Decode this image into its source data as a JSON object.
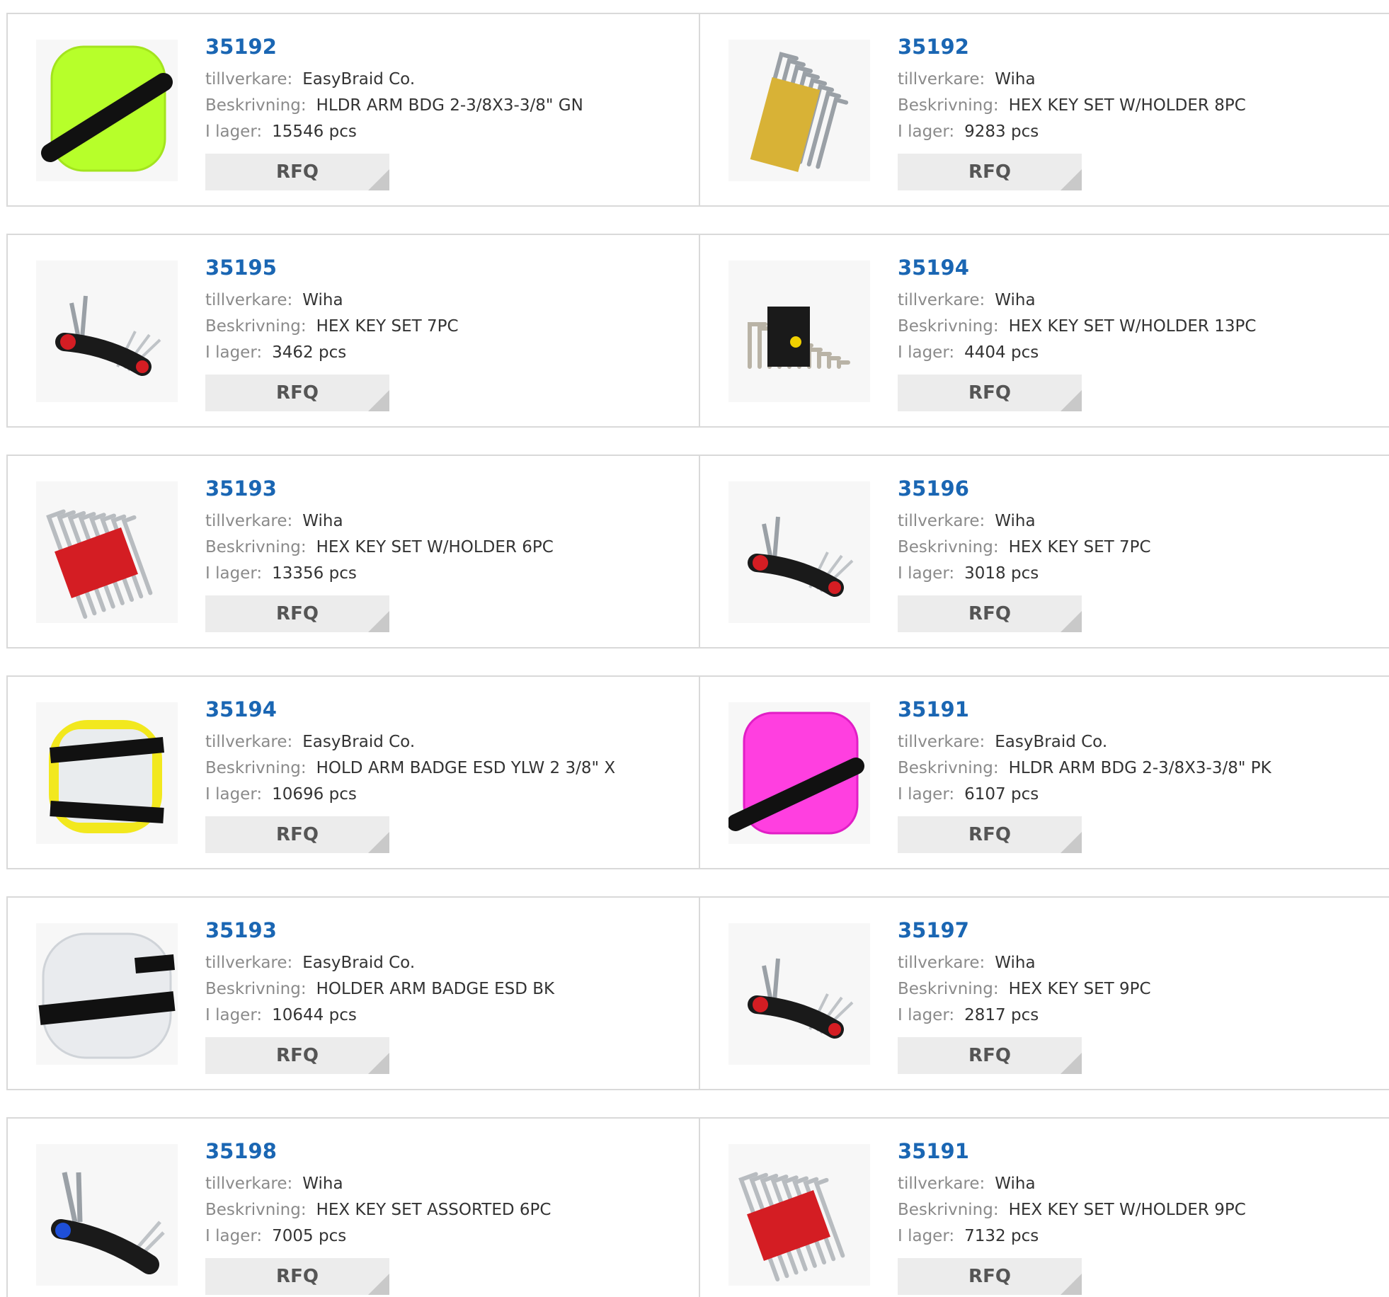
{
  "labels": {
    "manufacturer": "tillverkare:",
    "description": "Beskrivning:",
    "stock": "I lager:",
    "rfq": "RFQ"
  },
  "products": [
    {
      "part": "35192",
      "manufacturer": "EasyBraid Co.",
      "description": "HLDR ARM BDG 2-3/8X3-3/8\" GN",
      "stock": "15546 pcs",
      "image": "arm-badge-green"
    },
    {
      "part": "35192",
      "manufacturer": "Wiha",
      "description": "HEX KEY SET W/HOLDER 8PC",
      "stock": "9283 pcs",
      "image": "hex-key-holder-yellow"
    },
    {
      "part": "35195",
      "manufacturer": "Wiha",
      "description": "HEX KEY SET 7PC",
      "stock": "3462 pcs",
      "image": "folding-hex-key"
    },
    {
      "part": "35194",
      "manufacturer": "Wiha",
      "description": "HEX KEY SET W/HOLDER 13PC",
      "stock": "4404 pcs",
      "image": "hex-key-holder-black"
    },
    {
      "part": "35193",
      "manufacturer": "Wiha",
      "description": "HEX KEY SET W/HOLDER 6PC",
      "stock": "13356 pcs",
      "image": "hex-key-holder-red"
    },
    {
      "part": "35196",
      "manufacturer": "Wiha",
      "description": "HEX KEY SET 7PC",
      "stock": "3018 pcs",
      "image": "folding-hex-key"
    },
    {
      "part": "35194",
      "manufacturer": "EasyBraid Co.",
      "description": "HOLD ARM BADGE ESD YLW 2 3/8\" X",
      "stock": "10696 pcs",
      "image": "arm-badge-yellow"
    },
    {
      "part": "35191",
      "manufacturer": "EasyBraid Co.",
      "description": "HLDR ARM BDG 2-3/8X3-3/8\" PK",
      "stock": "6107 pcs",
      "image": "arm-badge-pink"
    },
    {
      "part": "35193",
      "manufacturer": "EasyBraid Co.",
      "description": "HOLDER ARM BADGE ESD BK",
      "stock": "10644 pcs",
      "image": "arm-badge-clear"
    },
    {
      "part": "35197",
      "manufacturer": "Wiha",
      "description": "HEX KEY SET 9PC",
      "stock": "2817 pcs",
      "image": "folding-hex-key"
    },
    {
      "part": "35198",
      "manufacturer": "Wiha",
      "description": "HEX KEY SET ASSORTED 6PC",
      "stock": "7005 pcs",
      "image": "folding-hex-key-blue"
    },
    {
      "part": "35191",
      "manufacturer": "Wiha",
      "description": "HEX KEY SET W/HOLDER 9PC",
      "stock": "7132 pcs",
      "image": "hex-key-holder-red"
    }
  ],
  "colors": {
    "link": "#1a66b3",
    "label": "#8a8a8a",
    "value": "#333333",
    "button_bg": "#ececec",
    "border": "#d9d9d9"
  }
}
